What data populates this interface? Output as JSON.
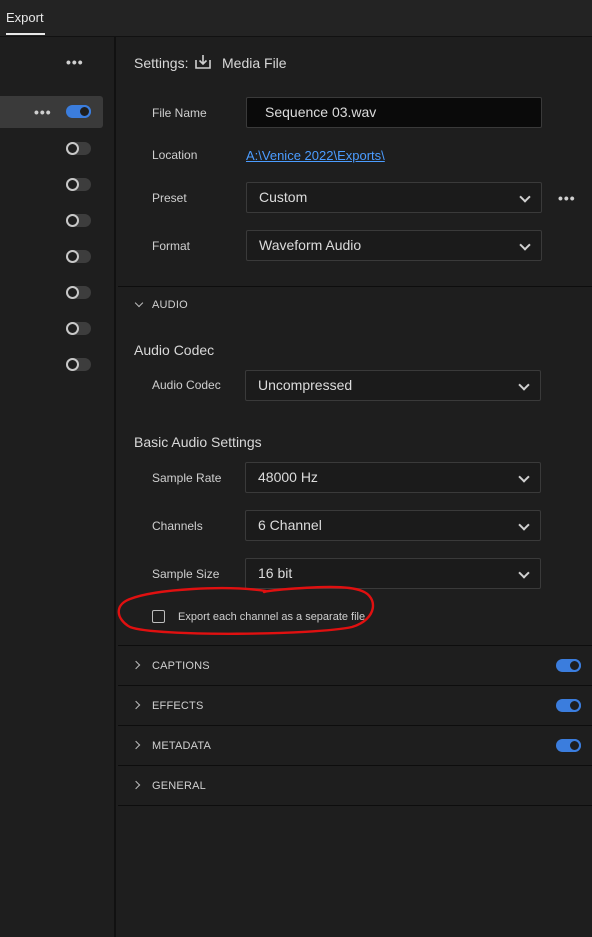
{
  "tab": {
    "label": "Export"
  },
  "left": {
    "more": "•••",
    "row_more": "•••",
    "toggles": [
      true,
      false,
      false,
      false,
      false,
      false,
      false,
      false
    ]
  },
  "settings": {
    "label": "Settings:",
    "target": "Media File",
    "file_name_label": "File Name",
    "file_name_value": "Sequence 03.wav",
    "location_label": "Location",
    "location_value": "A:\\Venice 2022\\Exports\\",
    "preset_label": "Preset",
    "preset_value": "Custom",
    "preset_more": "•••",
    "format_label": "Format",
    "format_value": "Waveform Audio"
  },
  "audio": {
    "section_title": "AUDIO",
    "codec_heading": "Audio Codec",
    "codec_label": "Audio Codec",
    "codec_value": "Uncompressed",
    "basic_heading": "Basic Audio Settings",
    "sample_rate_label": "Sample Rate",
    "sample_rate_value": "48000 Hz",
    "channels_label": "Channels",
    "channels_value": "6 Channel",
    "sample_size_label": "Sample Size",
    "sample_size_value": "16 bit",
    "export_each_label": "Export each channel as a separate file",
    "export_each_checked": false
  },
  "sections": [
    {
      "title": "CAPTIONS",
      "enabled": true
    },
    {
      "title": "EFFECTS",
      "enabled": true
    },
    {
      "title": "METADATA",
      "enabled": true
    },
    {
      "title": "GENERAL",
      "enabled": null
    }
  ],
  "colors": {
    "accent": "#3b7ddd",
    "link": "#4b9cff",
    "annotation": "#e01010"
  }
}
